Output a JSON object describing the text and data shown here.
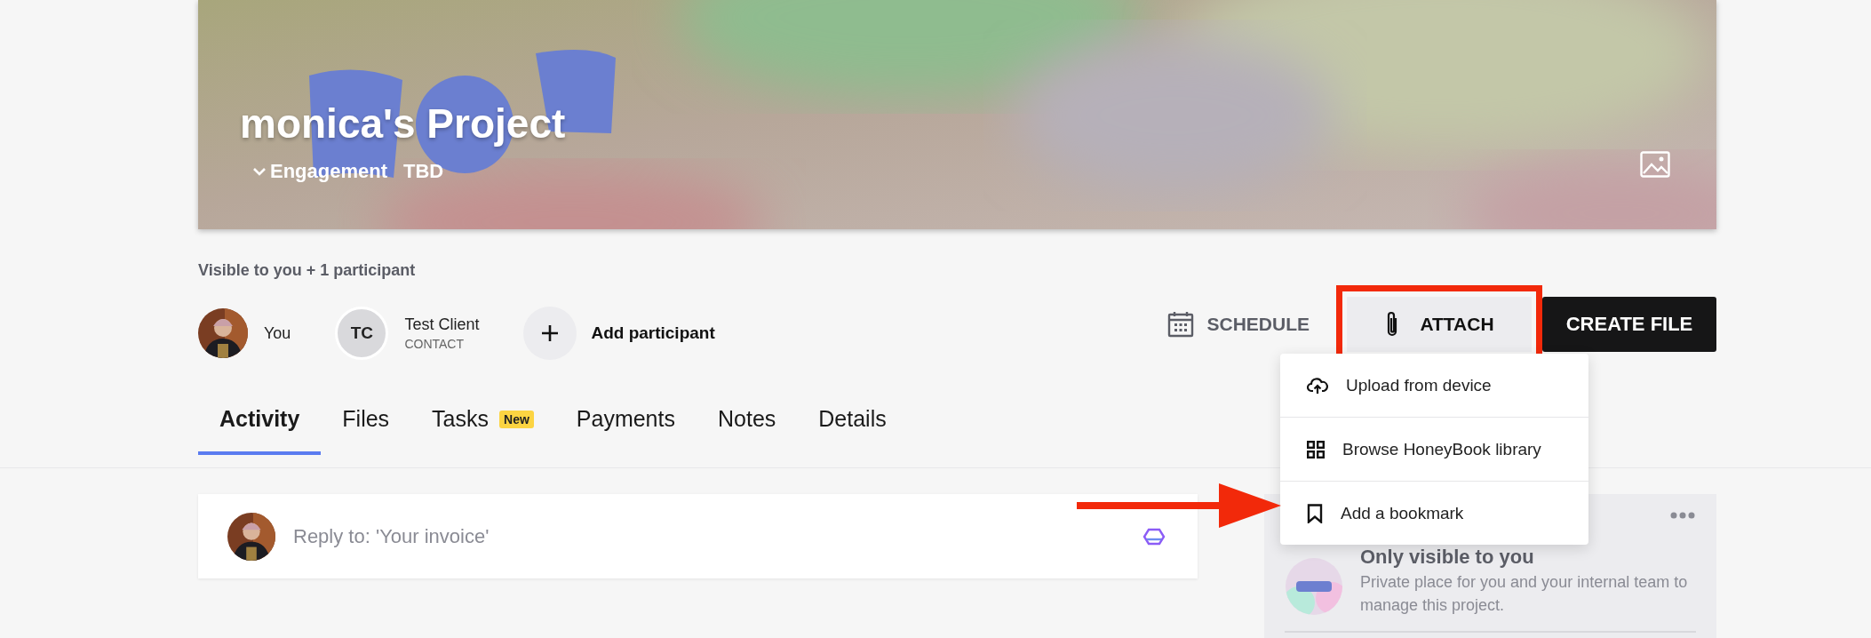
{
  "project": {
    "title": "monica's Project",
    "type": "Engagement",
    "date": "TBD"
  },
  "visibility": "Visible to you + 1 participant",
  "participants": [
    {
      "kind": "self",
      "name": "You"
    },
    {
      "kind": "contact",
      "initials": "TC",
      "name": "Test Client",
      "role": "CONTACT"
    }
  ],
  "add_participant": "Add participant",
  "actions": {
    "schedule": "SCHEDULE",
    "attach": "ATTACH",
    "create_file": "CREATE FILE"
  },
  "attach_menu": [
    {
      "kind": "upload",
      "label": "Upload from device"
    },
    {
      "kind": "library",
      "label": "Browse HoneyBook library"
    },
    {
      "kind": "bookmark",
      "label": "Add a bookmark"
    }
  ],
  "tabs": [
    {
      "label": "Activity",
      "selected": true
    },
    {
      "label": "Files",
      "selected": false
    },
    {
      "label": "Tasks",
      "badge": "New",
      "selected": false
    },
    {
      "label": "Payments",
      "selected": false
    },
    {
      "label": "Notes",
      "selected": false
    },
    {
      "label": "Details",
      "selected": false
    }
  ],
  "reply": {
    "placeholder": "Reply to: 'Your invoice'"
  },
  "private_panel": {
    "title": "Only visible to you",
    "description": "Private place for you and your internal team to manage this project."
  }
}
